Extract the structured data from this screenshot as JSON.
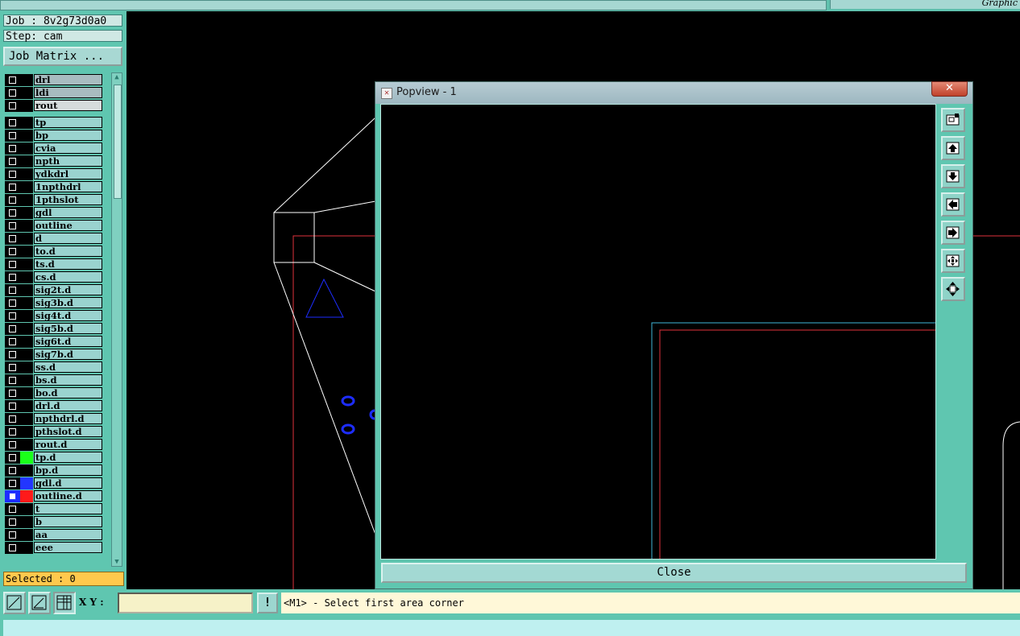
{
  "top_bar": {
    "right_title": "Graphic"
  },
  "left_panel": {
    "job_label": "Job : 8v2g73d0a0",
    "step_label": "Step: cam",
    "job_matrix_button": "Job Matrix ...",
    "selected_label": "Selected : 0",
    "layers": [
      {
        "name": "drl",
        "style": "gray",
        "color": ""
      },
      {
        "name": "ldi",
        "style": "gray",
        "color": ""
      },
      {
        "name": "rout",
        "style": "light",
        "color": ""
      },
      {
        "name": "tp",
        "style": "normal",
        "color": ""
      },
      {
        "name": "bp",
        "style": "normal",
        "color": ""
      },
      {
        "name": "cvia",
        "style": "normal",
        "color": ""
      },
      {
        "name": "npth",
        "style": "normal",
        "color": ""
      },
      {
        "name": "ydkdrl",
        "style": "normal",
        "color": ""
      },
      {
        "name": "1npthdrl",
        "style": "normal",
        "color": ""
      },
      {
        "name": "1pthslot",
        "style": "normal",
        "color": ""
      },
      {
        "name": "gdl",
        "style": "normal",
        "color": ""
      },
      {
        "name": "outline",
        "style": "normal",
        "color": ""
      },
      {
        "name": "d",
        "style": "normal",
        "color": ""
      },
      {
        "name": "to.d",
        "style": "normal",
        "color": ""
      },
      {
        "name": "ts.d",
        "style": "normal",
        "color": ""
      },
      {
        "name": "cs.d",
        "style": "normal",
        "color": ""
      },
      {
        "name": "sig2t.d",
        "style": "normal",
        "color": ""
      },
      {
        "name": "sig3b.d",
        "style": "normal",
        "color": ""
      },
      {
        "name": "sig4t.d",
        "style": "normal",
        "color": ""
      },
      {
        "name": "sig5b.d",
        "style": "normal",
        "color": ""
      },
      {
        "name": "sig6t.d",
        "style": "normal",
        "color": ""
      },
      {
        "name": "sig7b.d",
        "style": "normal",
        "color": ""
      },
      {
        "name": "ss.d",
        "style": "normal",
        "color": ""
      },
      {
        "name": "bs.d",
        "style": "normal",
        "color": ""
      },
      {
        "name": "bo.d",
        "style": "normal",
        "color": ""
      },
      {
        "name": "drl.d",
        "style": "normal",
        "color": ""
      },
      {
        "name": "npthdrl.d",
        "style": "normal",
        "color": ""
      },
      {
        "name": "pthslot.d",
        "style": "normal",
        "color": ""
      },
      {
        "name": "rout.d",
        "style": "normal",
        "color": ""
      },
      {
        "name": "tp.d",
        "style": "normal",
        "color": "#1aff1a"
      },
      {
        "name": "bp.d",
        "style": "normal",
        "color": ""
      },
      {
        "name": "gdl.d",
        "style": "normal",
        "color": "#2236ff"
      },
      {
        "name": "outline.d",
        "style": "normal",
        "color": "#ff1a1a",
        "active": true
      },
      {
        "name": "t",
        "style": "normal",
        "color": ""
      },
      {
        "name": "b",
        "style": "normal",
        "color": ""
      },
      {
        "name": "aa",
        "style": "normal",
        "color": ""
      },
      {
        "name": "eee",
        "style": "normal",
        "color": ""
      }
    ]
  },
  "popview": {
    "title": "Popview - 1",
    "close_x": "✕",
    "close_button": "Close",
    "tools": [
      "zoom-window-icon",
      "pan-up-icon",
      "pan-down-icon",
      "pan-left-icon",
      "pan-right-icon",
      "zoom-home-icon",
      "zoom-fit-icon"
    ]
  },
  "bottom_bar": {
    "xy_label": "X Y :",
    "xy_value": "",
    "alert_label": "!",
    "prompt": "<M1> - Select first area corner"
  },
  "colors": {
    "panel_bg": "#5fc6b0",
    "canvas_bg": "#000000",
    "profile_red": "#e0323c",
    "profile_cyan": "#3fb6d8",
    "feature_blue": "#1d2dff",
    "selected_bg": "#ffc94d"
  }
}
